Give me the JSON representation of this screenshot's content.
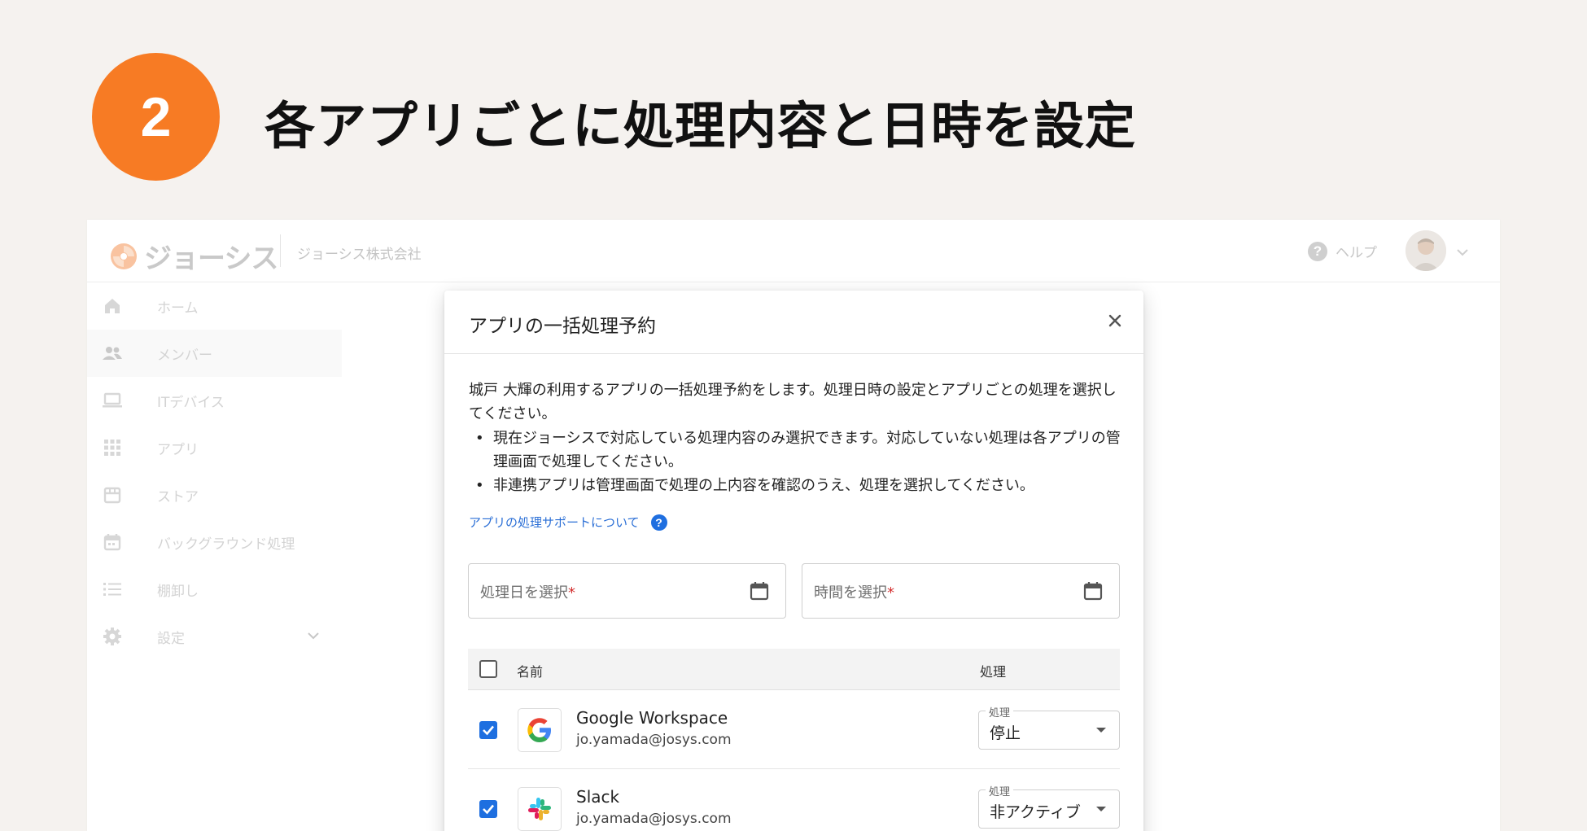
{
  "step": {
    "number": "2",
    "title": "各アプリごとに処理内容と日時を設定",
    "accent_color": "#f77b24"
  },
  "topbar": {
    "logo_text": "ジョーシス",
    "company": "ジョーシス株式会社",
    "help_label": "ヘルプ",
    "help_icon": "question-circle-icon",
    "avatar_icon": "user-avatar",
    "menu_icon": "chevron-down-icon"
  },
  "sidebar": {
    "items": [
      {
        "label": "ホーム",
        "icon": "home-icon"
      },
      {
        "label": "メンバー",
        "icon": "people-icon"
      },
      {
        "label": "ITデバイス",
        "icon": "laptop-icon"
      },
      {
        "label": "アプリ",
        "icon": "apps-grid-icon"
      },
      {
        "label": "ストア",
        "icon": "store-icon"
      },
      {
        "label": "バックグラウンド処理",
        "icon": "calendar-icon"
      },
      {
        "label": "棚卸し",
        "icon": "list-icon"
      },
      {
        "label": "設定",
        "icon": "gear-icon"
      }
    ]
  },
  "modal": {
    "title": "アプリの一括処理予約",
    "close_icon": "close-icon",
    "description": "城戸 大輝の利用するアプリの一括処理予約をします。処理日時の設定とアプリごとの処理を選択してください。",
    "bullets": [
      "現在ジョーシスで対応している処理内容のみ選択できます。対応していない処理は各アプリの管理画面で処理してください。",
      "非連携アプリは管理画面で処理の上内容を確認のうえ、処理を選択してください。"
    ],
    "support_link": "アプリの処理サポートについて",
    "support_icon": "help-circle-icon",
    "date_placeholder": "処理日を選択",
    "time_placeholder": "時間を選択",
    "required_mark": "*",
    "table": {
      "col_name": "名前",
      "col_action": "処理",
      "rows": [
        {
          "name": "Google Workspace",
          "email": "jo.yamada@josys.com",
          "checked": true,
          "select_label": "処理",
          "select_value": "停止",
          "logo": "google-logo"
        },
        {
          "name": "Slack",
          "email": "jo.yamada@josys.com",
          "checked": true,
          "select_label": "処理",
          "select_value": "非アクティブ",
          "logo": "slack-logo"
        }
      ]
    }
  }
}
